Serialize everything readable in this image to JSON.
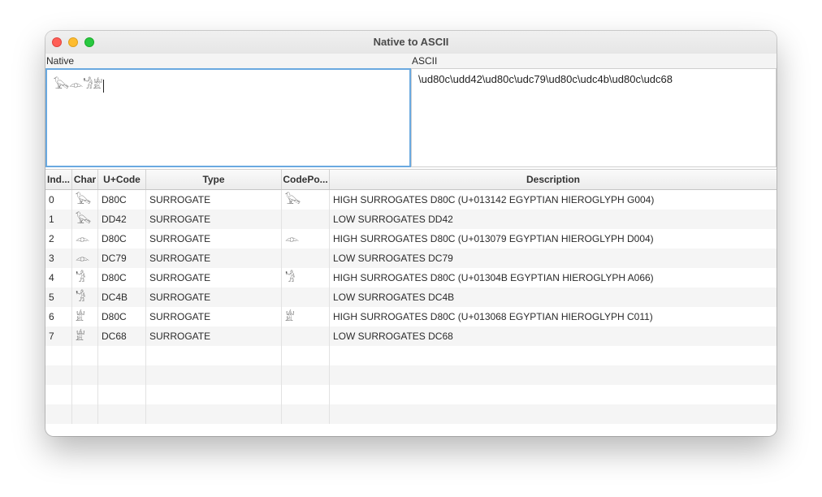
{
  "window": {
    "title": "Native to ASCII"
  },
  "native": {
    "label": "Native",
    "text": "𓅂𓁹𓁋𓁨"
  },
  "ascii": {
    "label": "ASCII",
    "text": "\\ud80c\\udd42\\ud80c\\udc79\\ud80c\\udc4b\\ud80c\\udc68"
  },
  "table": {
    "columns": [
      "Ind...",
      "Char",
      "U+Code",
      "Type",
      "CodePo...",
      "Description"
    ],
    "rows": [
      {
        "index": "0",
        "char": "𓅂",
        "ucode": "D80C",
        "type": "SURROGATE",
        "codepoint": "𓅂",
        "description": "HIGH SURROGATES D80C (U+013142 EGYPTIAN HIEROGLYPH G004)"
      },
      {
        "index": "1",
        "char": "𓅂",
        "ucode": "DD42",
        "type": "SURROGATE",
        "codepoint": "",
        "description": "LOW SURROGATES DD42"
      },
      {
        "index": "2",
        "char": "𓁹",
        "ucode": "D80C",
        "type": "SURROGATE",
        "codepoint": "𓁹",
        "description": "HIGH SURROGATES D80C (U+013079 EGYPTIAN HIEROGLYPH D004)"
      },
      {
        "index": "3",
        "char": "𓁹",
        "ucode": "DC79",
        "type": "SURROGATE",
        "codepoint": "",
        "description": "LOW SURROGATES DC79"
      },
      {
        "index": "4",
        "char": "𓁋",
        "ucode": "D80C",
        "type": "SURROGATE",
        "codepoint": "𓁋",
        "description": "HIGH SURROGATES D80C (U+01304B EGYPTIAN HIEROGLYPH A066)"
      },
      {
        "index": "5",
        "char": "𓁋",
        "ucode": "DC4B",
        "type": "SURROGATE",
        "codepoint": "",
        "description": "LOW SURROGATES DC4B"
      },
      {
        "index": "6",
        "char": "𓁨",
        "ucode": "D80C",
        "type": "SURROGATE",
        "codepoint": "𓁨",
        "description": "HIGH SURROGATES D80C (U+013068 EGYPTIAN HIEROGLYPH C011)"
      },
      {
        "index": "7",
        "char": "𓁨",
        "ucode": "DC68",
        "type": "SURROGATE",
        "codepoint": "",
        "description": "LOW SURROGATES DC68"
      }
    ]
  }
}
